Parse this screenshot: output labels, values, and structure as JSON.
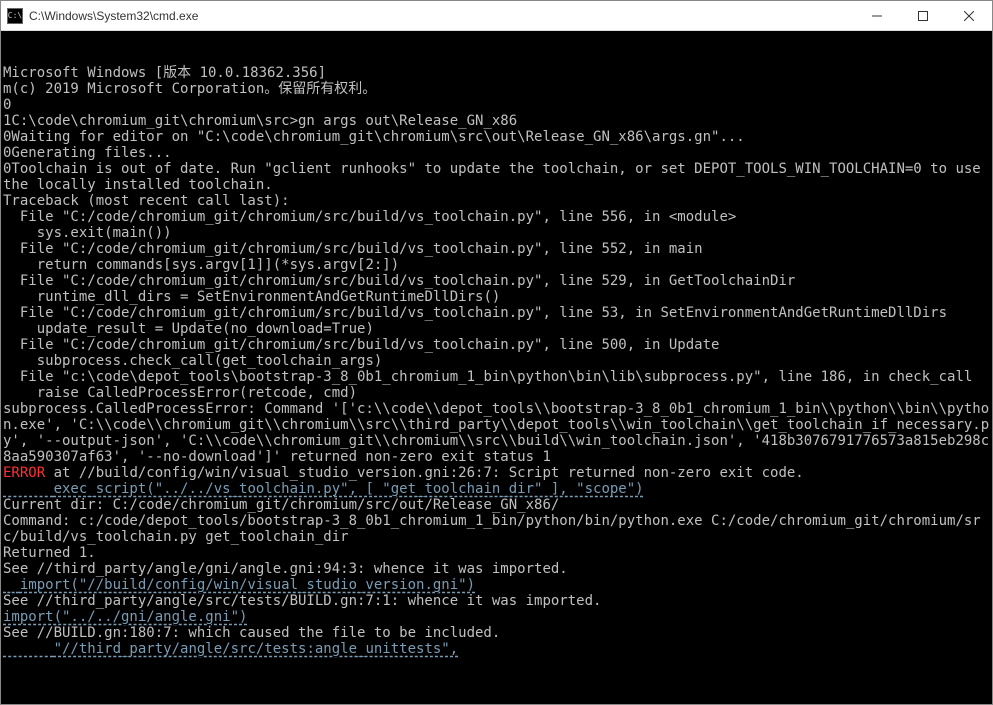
{
  "titlebar": {
    "icon_text": "C:\\",
    "title": "C:\\Windows\\System32\\cmd.exe"
  },
  "lines": [
    {
      "cls": "",
      "text": "Microsoft Windows [版本 10.0.18362.356]"
    },
    {
      "cls": "",
      "text": "m(c) 2019 Microsoft Corporation。保留所有权利。"
    },
    {
      "cls": "",
      "text": "0"
    },
    {
      "cls": "",
      "text": "1C:\\code\\chromium_git\\chromium\\src>gn args out\\Release_GN_x86"
    },
    {
      "cls": "",
      "text": "0Waiting for editor on \"C:\\code\\chromium_git\\chromium\\src\\out\\Release_GN_x86\\args.gn\"..."
    },
    {
      "cls": "",
      "text": "0Generating files..."
    },
    {
      "cls": "",
      "text": "0Toolchain is out of date. Run \"gclient runhooks\" to update the toolchain, or set DEPOT_TOOLS_WIN_TOOLCHAIN=0 to use the locally installed toolchain."
    },
    {
      "cls": "",
      "text": "Traceback (most recent call last):"
    },
    {
      "cls": "",
      "text": "  File \"C:/code/chromium_git/chromium/src/build/vs_toolchain.py\", line 556, in <module>"
    },
    {
      "cls": "",
      "text": "    sys.exit(main())"
    },
    {
      "cls": "",
      "text": "  File \"C:/code/chromium_git/chromium/src/build/vs_toolchain.py\", line 552, in main"
    },
    {
      "cls": "",
      "text": "    return commands[sys.argv[1]](*sys.argv[2:])"
    },
    {
      "cls": "",
      "text": "  File \"C:/code/chromium_git/chromium/src/build/vs_toolchain.py\", line 529, in GetToolchainDir"
    },
    {
      "cls": "",
      "text": "    runtime_dll_dirs = SetEnvironmentAndGetRuntimeDllDirs()"
    },
    {
      "cls": "",
      "text": "  File \"C:/code/chromium_git/chromium/src/build/vs_toolchain.py\", line 53, in SetEnvironmentAndGetRuntimeDllDirs"
    },
    {
      "cls": "",
      "text": "    update_result = Update(no_download=True)"
    },
    {
      "cls": "",
      "text": "  File \"C:/code/chromium_git/chromium/src/build/vs_toolchain.py\", line 500, in Update"
    },
    {
      "cls": "",
      "text": "    subprocess.check_call(get_toolchain_args)"
    },
    {
      "cls": "",
      "text": "  File \"c:\\code\\depot_tools\\bootstrap-3_8_0b1_chromium_1_bin\\python\\bin\\lib\\subprocess.py\", line 186, in check_call"
    },
    {
      "cls": "",
      "text": "    raise CalledProcessError(retcode, cmd)"
    },
    {
      "cls": "",
      "text": "subprocess.CalledProcessError: Command '['c:\\\\code\\\\depot_tools\\\\bootstrap-3_8_0b1_chromium_1_bin\\\\python\\\\bin\\\\python.exe', 'C:\\\\code\\\\chromium_git\\\\chromium\\\\src\\\\third_party\\\\depot_tools\\\\win_toolchain\\\\get_toolchain_if_necessary.py', '--output-json', 'C:\\\\code\\\\chromium_git\\\\chromium\\\\src\\\\build\\\\win_toolchain.json', '418b3076791776573a815eb298c8aa590307af63', '--no-download']' returned non-zero exit status 1"
    },
    {
      "cls": "err-line",
      "pre": "ERROR",
      "post": " at //build/config/win/visual_studio_version.gni:26:7: Script returned non-zero exit code."
    },
    {
      "cls": "dim udl",
      "text": "      exec_script(\"../../vs_toolchain.py\", [ \"get_toolchain_dir\" ], \"scope\")"
    },
    {
      "cls": "",
      "text": ""
    },
    {
      "cls": "",
      "text": "Current dir: C:/code/chromium_git/chromium/src/out/Release_GN_x86/"
    },
    {
      "cls": "",
      "text": "Command: c:/code/depot_tools/bootstrap-3_8_0b1_chromium_1_bin/python/bin/python.exe C:/code/chromium_git/chromium/src/build/vs_toolchain.py get_toolchain_dir"
    },
    {
      "cls": "",
      "text": "Returned 1."
    },
    {
      "cls": "",
      "text": "See //third_party/angle/gni/angle.gni:94:3: whence it was imported."
    },
    {
      "cls": "dim udl",
      "text": "  import(\"//build/config/win/visual_studio_version.gni\")"
    },
    {
      "cls": "",
      "text": ""
    },
    {
      "cls": "",
      "text": "See //third_party/angle/src/tests/BUILD.gn:7:1: whence it was imported."
    },
    {
      "cls": "dim udl",
      "text": "import(\"../../gni/angle.gni\")"
    },
    {
      "cls": "",
      "text": ""
    },
    {
      "cls": "",
      "text": "See //BUILD.gn:180:7: which caused the file to be included."
    },
    {
      "cls": "dim udl",
      "text": "      \"//third_party/angle/src/tests:angle_unittests\","
    }
  ]
}
